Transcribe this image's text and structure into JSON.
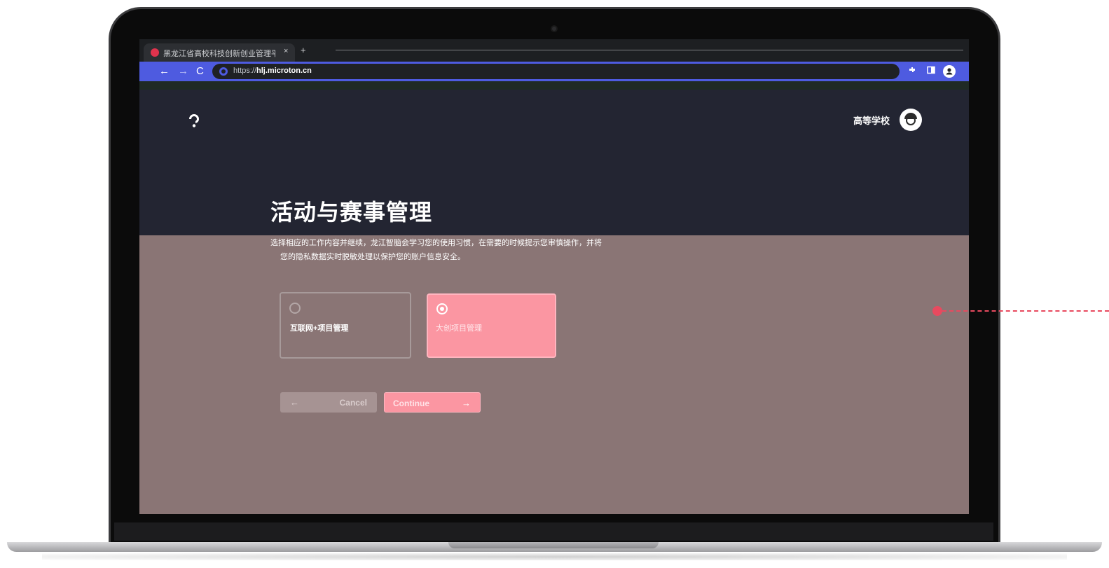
{
  "browser": {
    "tab_title": "黑龙江省高校科技创新创业管理平台",
    "tab_close": "×",
    "new_tab": "+",
    "nav": {
      "back": "←",
      "forward": "→",
      "reload": "C"
    },
    "url_scheme": "https://",
    "url_host": "hlj.microton.cn",
    "toolbar_icons": {
      "extensions": "extensions-icon",
      "side_panel": "side-panel-icon",
      "profile": "profile-icon"
    }
  },
  "header": {
    "org_name": "高等学校",
    "logo": "brand-logo-icon",
    "avatar": "user-avatar"
  },
  "main": {
    "title": "活动与赛事管理",
    "description_line1": "选择相应的工作内容并继续，龙江智脑会学习您的使用习惯，在需要的时候提示您审慎操作，并将",
    "description_line2": "您的隐私数据实时脱敏处理以保护您的账户信息安全。",
    "options": [
      {
        "label": "互联网+项目管理",
        "selected": false
      },
      {
        "label": "大创项目管理",
        "selected": true
      }
    ],
    "cancel_label": "Cancel",
    "continue_label": "Continue",
    "cancel_arrow": "←",
    "continue_arrow": "→"
  },
  "colors": {
    "accent": "#fb96a2",
    "browser_toolbar": "#4e5be0",
    "header_bg": "#232532",
    "page_bg": "#8a7575",
    "callout": "#e84a5f"
  }
}
